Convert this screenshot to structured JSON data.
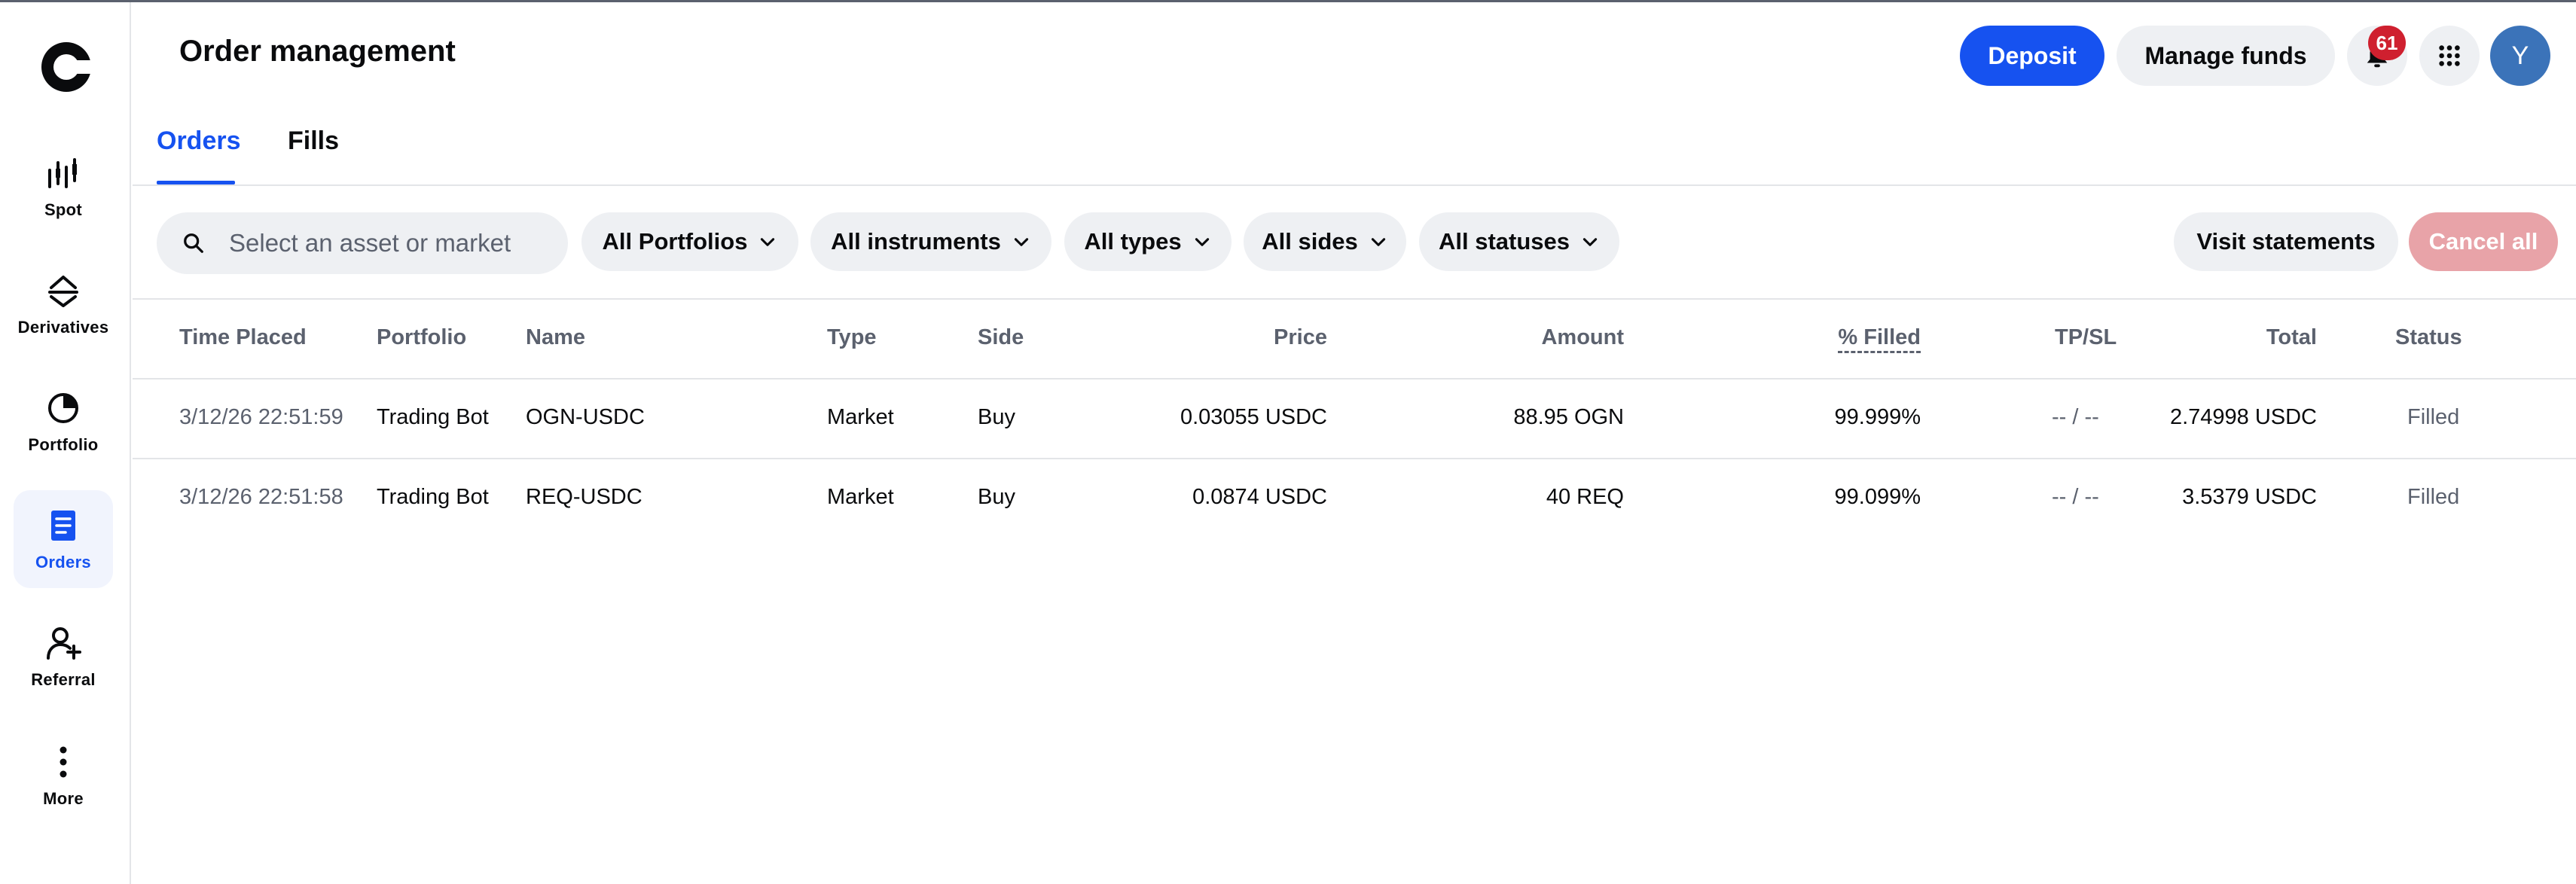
{
  "colors": {
    "primary": "#1652f0",
    "danger_disabled": "#e8a3a8",
    "badge": "#cf202f",
    "avatar": "#3b73b9"
  },
  "sidebar": {
    "items": [
      {
        "label": "Spot",
        "icon": "candlestick-icon"
      },
      {
        "label": "Derivatives",
        "icon": "derivatives-icon"
      },
      {
        "label": "Portfolio",
        "icon": "pie-chart-icon"
      },
      {
        "label": "Orders",
        "icon": "document-icon",
        "active": true
      },
      {
        "label": "Referral",
        "icon": "add-user-icon"
      },
      {
        "label": "More",
        "icon": "more-vertical-icon"
      }
    ]
  },
  "header": {
    "title": "Order management",
    "deposit_label": "Deposit",
    "manage_funds_label": "Manage funds",
    "notification_count": "61",
    "avatar_initial": "Y"
  },
  "tabs": [
    {
      "label": "Orders",
      "active": true
    },
    {
      "label": "Fills",
      "active": false
    }
  ],
  "filters": {
    "search_placeholder": "Select an asset or market",
    "portfolios": "All Portfolios",
    "instruments": "All instruments",
    "types": "All types",
    "sides": "All sides",
    "statuses": "All statuses",
    "visit_statements": "Visit statements",
    "cancel_all": "Cancel all"
  },
  "table": {
    "columns": {
      "time": "Time Placed",
      "portfolio": "Portfolio",
      "name": "Name",
      "type": "Type",
      "side": "Side",
      "price": "Price",
      "amount": "Amount",
      "filled": "% Filled",
      "tpsl": "TP/SL",
      "total": "Total",
      "status": "Status"
    },
    "rows": [
      {
        "time": "3/12/26 22:51:59",
        "portfolio": "Trading Bot",
        "name": "OGN-USDC",
        "type": "Market",
        "side": "Buy",
        "price": "0.03055 USDC",
        "amount": "88.95 OGN",
        "filled": "99.999%",
        "tpsl": "-- / --",
        "total": "2.74998 USDC",
        "status": "Filled"
      },
      {
        "time": "3/12/26 22:51:58",
        "portfolio": "Trading Bot",
        "name": "REQ-USDC",
        "type": "Market",
        "side": "Buy",
        "price": "0.0874 USDC",
        "amount": "40 REQ",
        "filled": "99.099%",
        "tpsl": "-- / --",
        "total": "3.5379 USDC",
        "status": "Filled"
      }
    ]
  }
}
